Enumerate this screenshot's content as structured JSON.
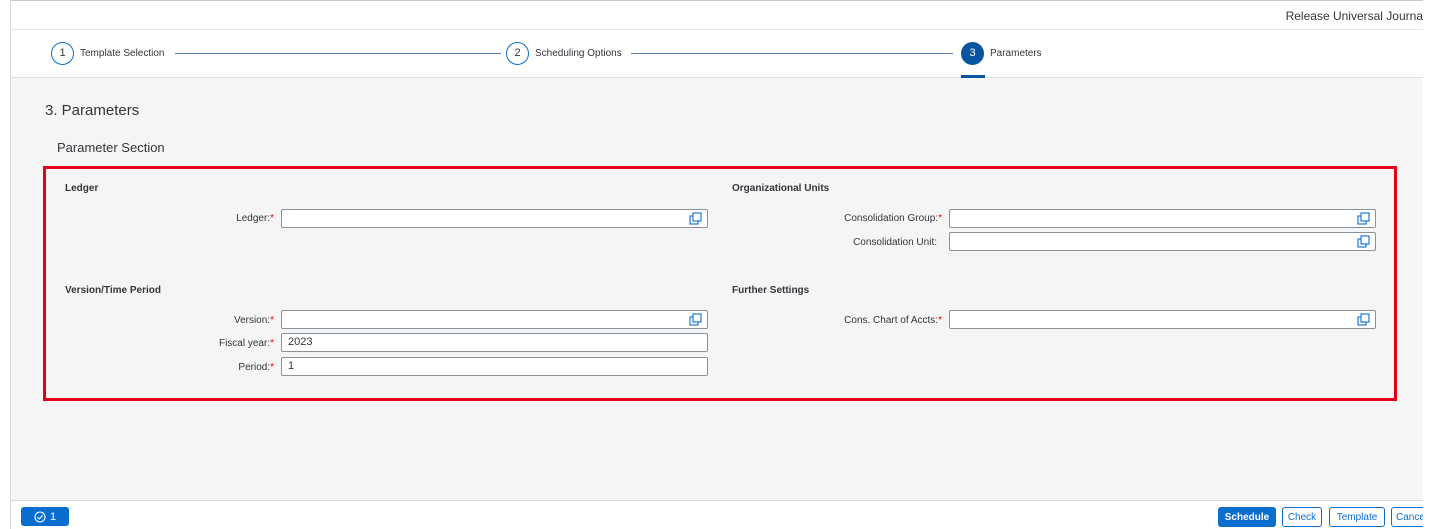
{
  "app": {
    "title": "Release Universal Journa"
  },
  "wizard": {
    "steps": [
      {
        "number": "1",
        "label": "Template Selection"
      },
      {
        "number": "2",
        "label": "Scheduling Options"
      },
      {
        "number": "3",
        "label": "Parameters"
      }
    ]
  },
  "page": {
    "heading": "3. Parameters",
    "section_title": "Parameter Section"
  },
  "groups": {
    "ledger": {
      "title": "Ledger",
      "fields": {
        "ledger": {
          "label": "Ledger:",
          "value": ""
        }
      }
    },
    "version_time": {
      "title": "Version/Time Period",
      "fields": {
        "version": {
          "label": "Version:",
          "value": ""
        },
        "fiscal_year": {
          "label": "Fiscal year:",
          "value": "2023"
        },
        "period": {
          "label": "Period:",
          "value": "1"
        }
      }
    },
    "org_units": {
      "title": "Organizational Units",
      "fields": {
        "cons_group": {
          "label": "Consolidation Group:",
          "value": ""
        },
        "cons_unit": {
          "label": "Consolidation Unit:",
          "value": ""
        }
      }
    },
    "further": {
      "title": "Further Settings",
      "fields": {
        "chart_of_accts": {
          "label": "Cons. Chart of Accts:",
          "value": ""
        }
      }
    }
  },
  "required_marker": "*",
  "footer": {
    "message_count": "1",
    "buttons": {
      "schedule": "Schedule",
      "check": "Check",
      "template": "Template",
      "cancel": "Cance"
    }
  },
  "colors": {
    "accent": "#0a6ed1",
    "highlight_border": "#e3001b",
    "active_step": "#0854a0"
  }
}
